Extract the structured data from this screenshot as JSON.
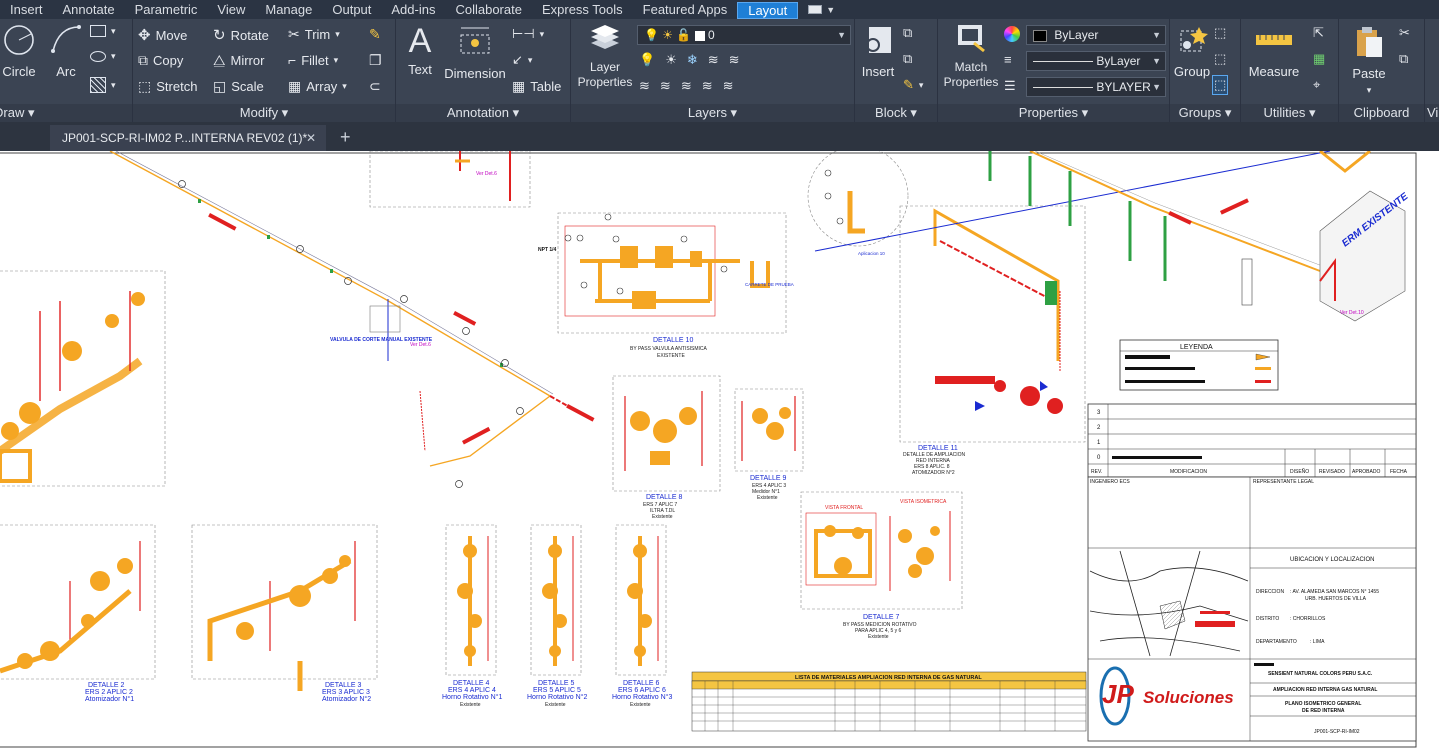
{
  "menu_tabs": [
    "Insert",
    "Annotate",
    "Parametric",
    "View",
    "Manage",
    "Output",
    "Add-ins",
    "Collaborate",
    "Express Tools",
    "Featured Apps",
    "Layout"
  ],
  "active_tab": "Layout",
  "ribbon": {
    "draw": {
      "circle": "Circle",
      "arc": "Arc",
      "title": "Draw ▾"
    },
    "modify": {
      "move": "Move",
      "rotate": "Rotate",
      "trim": "Trim",
      "copy": "Copy",
      "mirror": "Mirror",
      "fillet": "Fillet",
      "stretch": "Stretch",
      "scale": "Scale",
      "array": "Array",
      "title": "Modify ▾"
    },
    "annotation": {
      "text": "Text",
      "dimension": "Dimension",
      "table": "Table",
      "title": "Annotation ▾"
    },
    "layers": {
      "layer_properties": "Layer Properties",
      "layer_value": "0",
      "title": "Layers ▾"
    },
    "block": {
      "insert": "Insert",
      "title": "Block ▾"
    },
    "properties": {
      "match": "Match Properties",
      "color": "ByLayer",
      "linetype": "ByLayer",
      "lineweight": "BYLAYER",
      "title": "Properties ▾"
    },
    "groups": {
      "group": "Group",
      "title": "Groups ▾"
    },
    "utilities": {
      "measure": "Measure",
      "title": "Utilities ▾"
    },
    "clipboard": {
      "paste": "Paste",
      "title": "Clipboard"
    },
    "view_cut": "Vi"
  },
  "document_tab": "JP001-SCP-RI-IM02 P...INTERNA REV02 (1)*",
  "drawing": {
    "details": [
      {
        "title": "DETALLE 10",
        "sub": "BY PASS VALVULA ANTISISMICA",
        "sub2": "EXISTENTE"
      },
      {
        "title": "DETALLE 8",
        "sub": "ERS 7 APLIC 7",
        "sub2": "ILTRA T.DL",
        "sub3": "Existente"
      },
      {
        "title": "DETALLE 9",
        "sub": "ERS 4 APLIC 3",
        "sub2": "Medidor N°1",
        "sub3": "Existente"
      },
      {
        "title": "DETALLE 11",
        "sub": "DETALLE DE AMPLIACION",
        "sub2": "RED INTERNA",
        "sub3": "ERS 8 APLIC. 8",
        "sub4": "ATOMIZADOR N°2"
      },
      {
        "title": "DETALLE 7",
        "sub": "BY PASS MEDICION ROTATIVO",
        "sub2": "PARA APLIC 4, 5 y 6",
        "sub3": "Existente"
      },
      {
        "title": "DETALLE 2",
        "sub": "ERS 2 APLIC 2",
        "sub2": "Atomizador N°1"
      },
      {
        "title": "DETALLE 3",
        "sub": "ERS 3 APLIC 3",
        "sub2": "Atomizador N°2"
      },
      {
        "title": "DETALLE 4",
        "sub": "ERS 4 APLIC 4",
        "sub2": "Horno Rotativo N°1",
        "sub3": "Existente"
      },
      {
        "title": "DETALLE 5",
        "sub": "ERS 5 APLIC 5",
        "sub2": "Horno Rotativo N°2",
        "sub3": "Existente"
      },
      {
        "title": "DETALLE 6",
        "sub": "ERS 6 APLIC 6",
        "sub2": "Horno Rotativo N°3",
        "sub3": "Existente"
      }
    ],
    "valve_label": "VALVULA DE CORTE MANUAL EXISTENTE",
    "ver_det6": "Ver Det.6",
    "ver_det10": "Ver Det.10",
    "carrete": "CARRETE DE PRUEBA",
    "vista_frontal": "VISTA FRONTAL",
    "vista_isometrica": "VISTA ISOMETRICA",
    "erm_existente": "ERM EXISTENTE",
    "legend_title": "LEYENDA",
    "rev_table": {
      "rows": [
        "3",
        "2",
        "1",
        "0"
      ],
      "headers": [
        "REV.",
        "MODIFICACION",
        "DISEÑO",
        "REVISADO",
        "APROBADO",
        "FECHA"
      ]
    },
    "ingeniero": "INGENIERO ECS",
    "representante": "REPRESENTANTE LEGAL",
    "ubicacion": "UBICACION Y LOCALIZACION",
    "direccion_label": "DIRECCION",
    "direccion": ": AV. ALAMEDA SAN MARCOS N° 1455",
    "direccion2": "URB. HUERTOS DE VILLA",
    "distrito_label": "DISTRITO",
    "distrito": ": CHORRILLOS",
    "departamento_label": "DEPARTAMENTO",
    "departamento": ": LIMA",
    "company": "SENSIENT NATURAL COLORS PERU S.A.C.",
    "project": "AMPLIACION RED INTERNA GAS NATURAL",
    "plan_title": "PLANO ISOMETRICO GENERAL",
    "plan_title2": "DE RED INTERNA",
    "sheet_code": "JP001-SCP-RI-IM02",
    "logo_jp": "JP",
    "logo_text": "Soluciones",
    "materials_title": "LISTA DE MATERIALES AMPLIACION RED INTERNA DE GAS NATURAL"
  },
  "colors": {
    "ribbon": "#3b4453",
    "tabbar": "#2b3443",
    "accent": "#1f7fd6",
    "pipe_orange": "#f5a623",
    "pipe_red": "#e02020",
    "pipe_blue": "#1a2bd1",
    "pipe_green": "#2ea043"
  }
}
